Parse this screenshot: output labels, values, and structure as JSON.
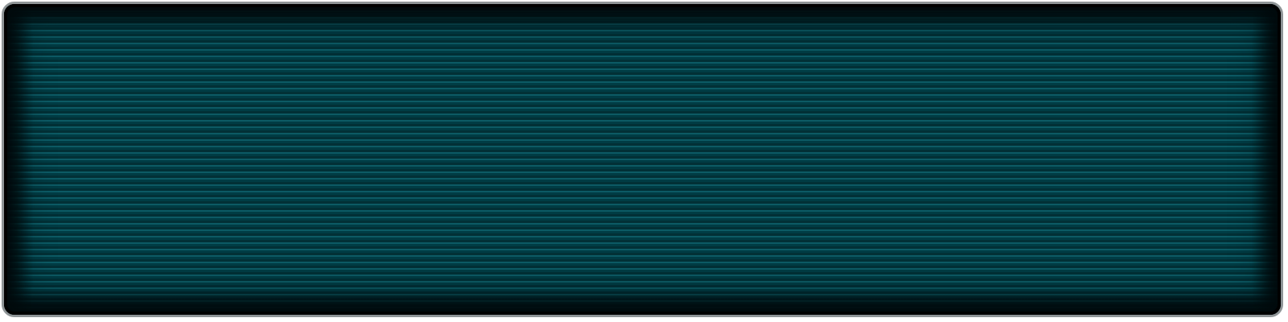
{
  "ribbon": {
    "colors": {
      "field": "#003c44",
      "stripe_light": "#0c5a64",
      "stripe_dark": "#023036",
      "border": "#8f9597",
      "edge_shadow": "#0a1a1c"
    },
    "pattern": "horizontal-pinstripes"
  }
}
